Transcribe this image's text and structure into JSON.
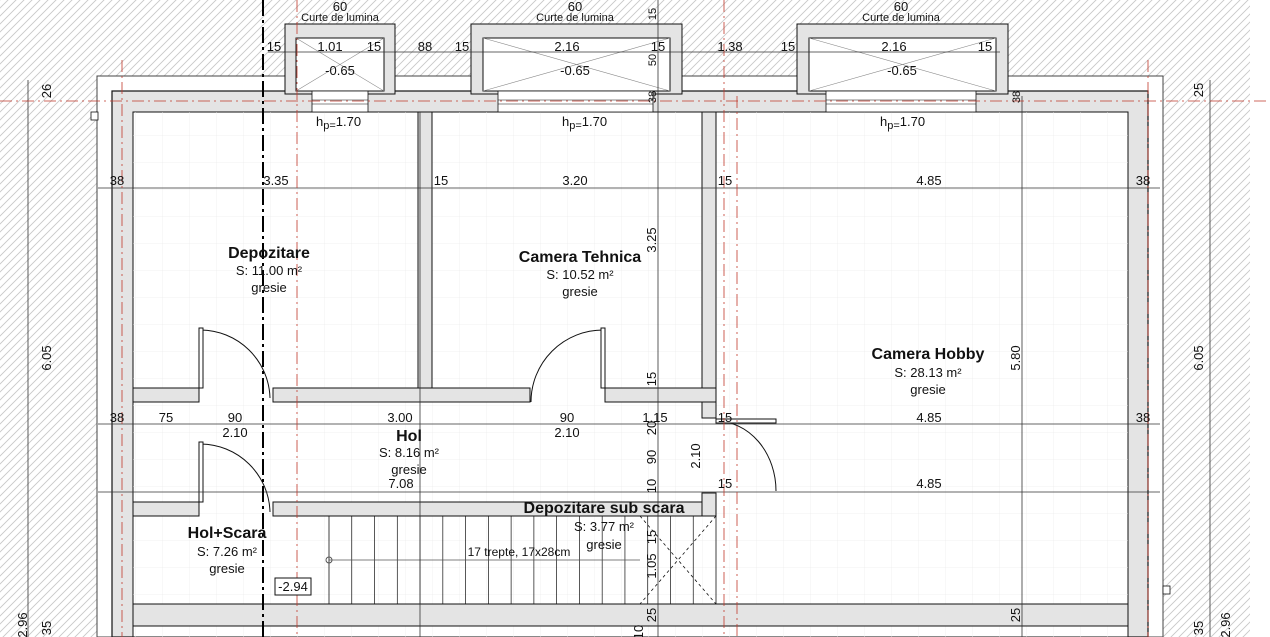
{
  "rooms": {
    "depozitare": {
      "name": "Depozitare",
      "area": "S: 11.00 m²",
      "floor": "gresie"
    },
    "camera_tehnica": {
      "name": "Camera Tehnica",
      "area": "S: 10.52 m²",
      "floor": "gresie"
    },
    "camera_hobby": {
      "name": "Camera Hobby",
      "area": "S: 28.13 m²",
      "floor": "gresie"
    },
    "hol": {
      "name": "Hol",
      "area": "S: 8.16 m²",
      "floor": "gresie"
    },
    "hol_scara": {
      "name": "Hol+Scara",
      "area": "S: 7.26 m²",
      "floor": "gresie"
    },
    "depozitare_sub_scara": {
      "name": "Depozitare sub scara",
      "area": "S: 3.77 m²",
      "floor": "gresie"
    }
  },
  "light_courts": {
    "label": "Curte de lumina",
    "width": "60",
    "left": {
      "inner": "1.01",
      "side_a": "15",
      "side_b": "15",
      "level": "-0.65"
    },
    "middle": {
      "inner": "2.16",
      "side_a": "15",
      "side_b": "15",
      "level": "-0.65"
    },
    "right": {
      "inner": "2.16",
      "side_a": "15",
      "side_b": "15",
      "level": "-0.65"
    }
  },
  "sill_height": "1.70",
  "sill_prefix": "h",
  "sill_sub": "p=",
  "stairs": {
    "note": "17 trepte, 17x28cm",
    "level": "-2.94"
  },
  "dims": {
    "top_gap_1": "88",
    "top_gap_2": "1.38",
    "court_depth": "15",
    "court_depth_2": "50",
    "court_wall": "38",
    "court_wall_r": "38",
    "left_outer_top": "26",
    "left_total": "6.05",
    "left_bottom": "2.96",
    "left_bottom_2": "35",
    "right_outer_top": "25",
    "right_total": "6.05",
    "right_bottom": "2.96",
    "right_bottom_2": "35",
    "row1": {
      "wall_l": "38",
      "room1": "3.35",
      "wall_1": "15",
      "room2": "3.20",
      "wall_2": "15",
      "room3": "4.85",
      "wall_r": "38"
    },
    "row2": {
      "wall_l": "38",
      "seg_75": "75",
      "door_1": "90",
      "hol": "3.00",
      "door_2": "90",
      "seg_115": "1.15",
      "wall_2": "15",
      "room3": "4.85",
      "wall_r": "38"
    },
    "row2_sub": {
      "a": "2.10",
      "b": "2.10"
    },
    "row3": {
      "total": "7.08",
      "wall": "15",
      "room3": "4.85"
    },
    "v_tehnica": "3.25",
    "v_hobby": "5.80",
    "v_15": "15",
    "v_20": "20",
    "v_90": "90",
    "v_210": "2.10",
    "v_10": "10",
    "v_15b": "15",
    "v_105": "1.05",
    "v_25": "25",
    "v_10b": "10",
    "v_25b": "25"
  }
}
